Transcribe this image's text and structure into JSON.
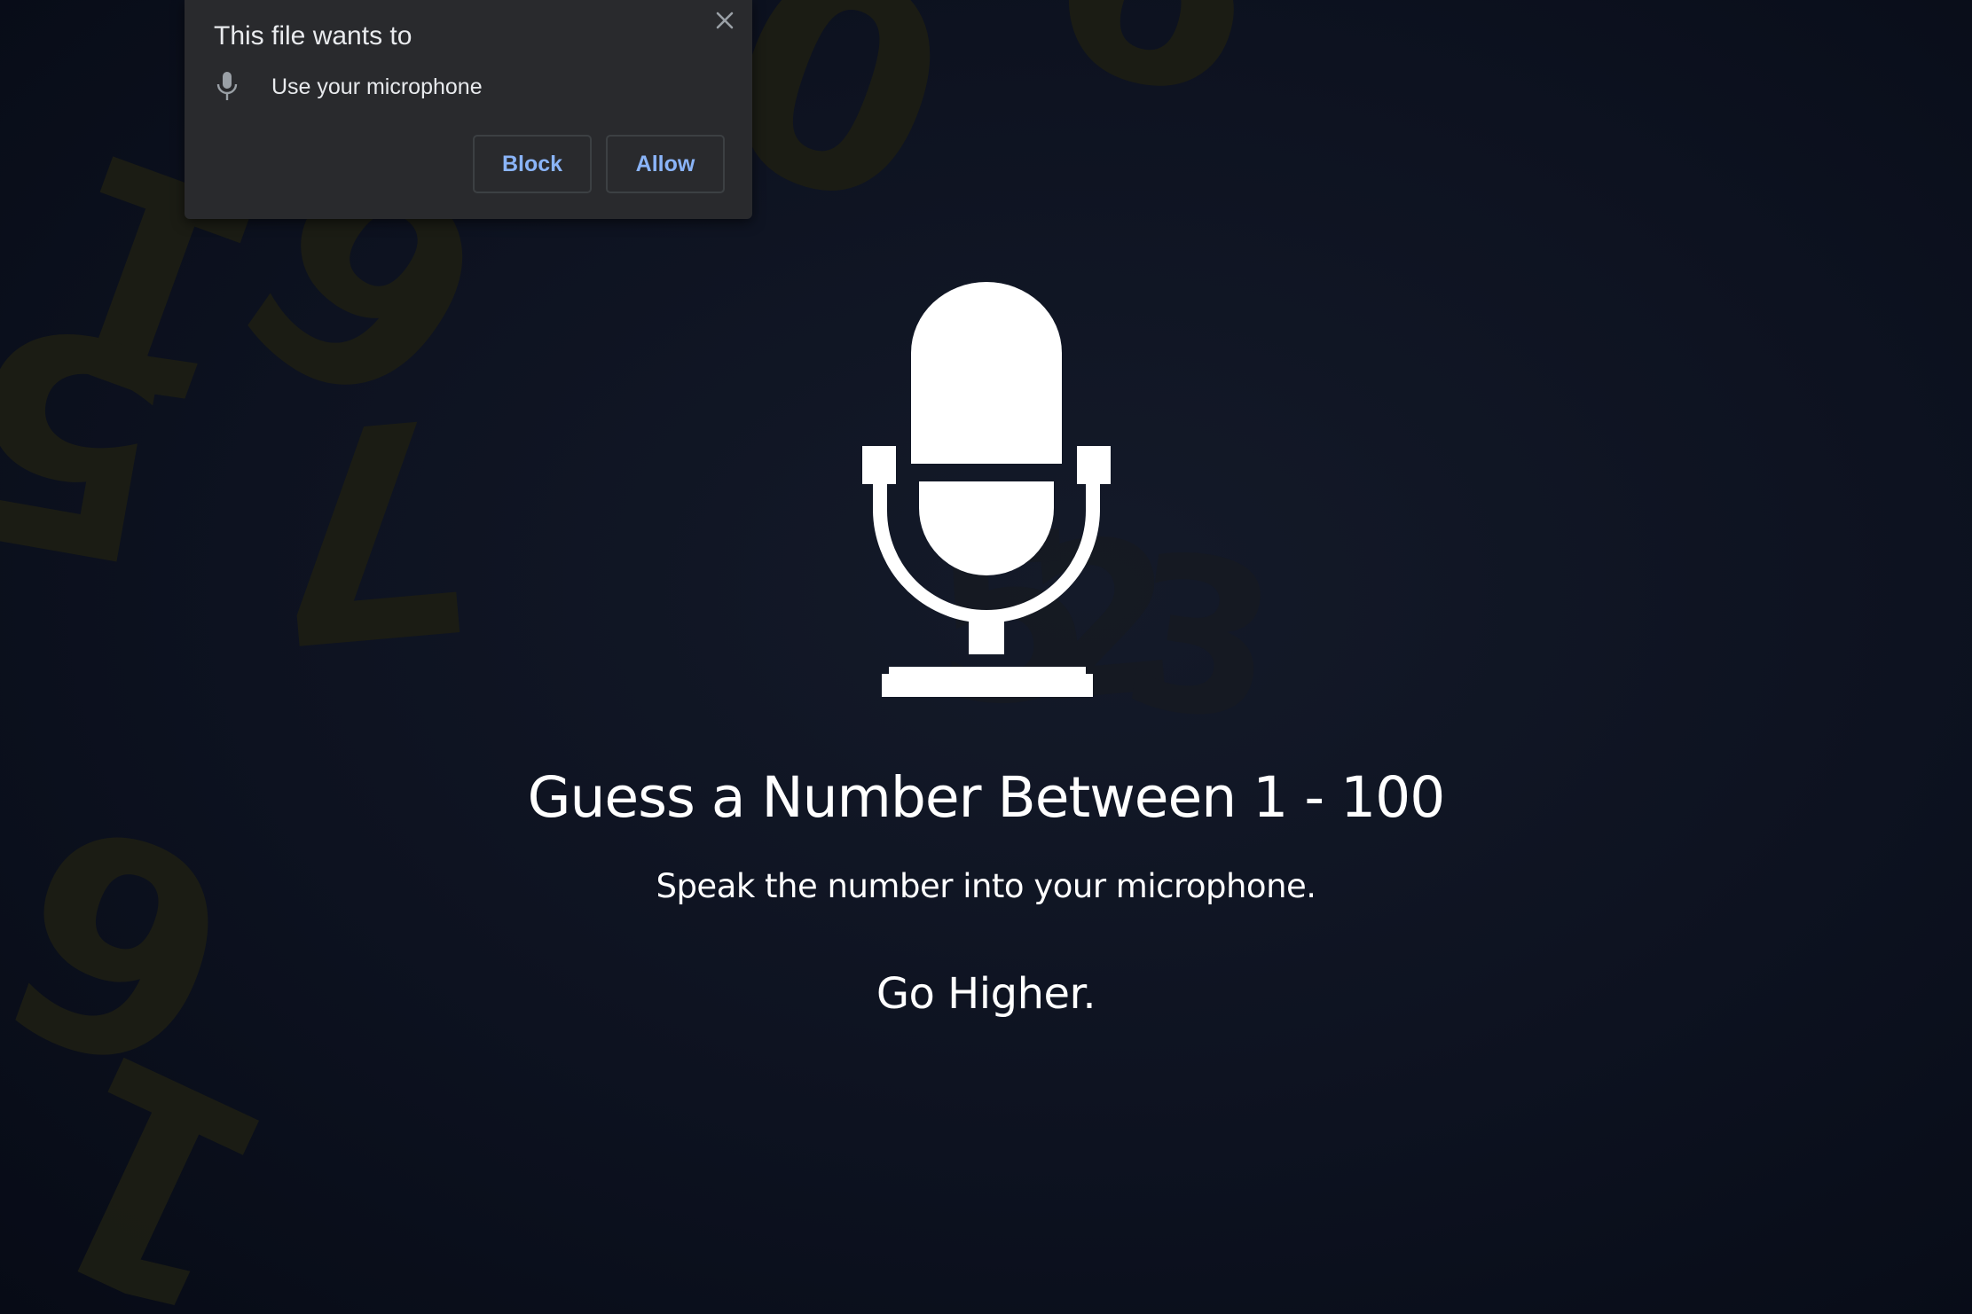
{
  "permission_popup": {
    "title": "This file wants to",
    "request_label": "Use your microphone",
    "request_icon": "microphone-icon",
    "close_icon": "close-icon",
    "block_label": "Block",
    "allow_label": "Allow"
  },
  "game": {
    "icon": "microphone-icon",
    "title": "Guess a Number Between 1 - 100",
    "subtitle": "Speak the number into your microphone.",
    "feedback": "Go Higher."
  },
  "background_digits": [
    "1",
    "5",
    "6",
    "0",
    "9",
    "7",
    "1",
    "2",
    "3",
    "5",
    "6"
  ],
  "colors": {
    "background": "#0d1220",
    "popup_background": "#292a2d",
    "button_text": "#8ab4f8",
    "text": "#ffffff"
  }
}
